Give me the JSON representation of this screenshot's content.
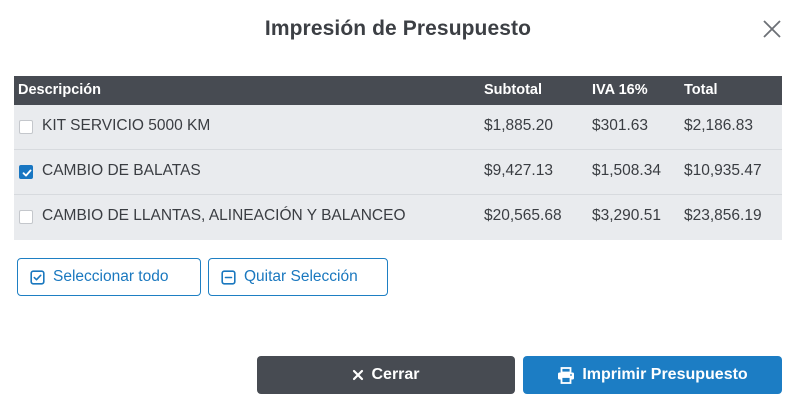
{
  "dialog": {
    "title": "Impresión de Presupuesto"
  },
  "table": {
    "headers": {
      "description": "Descripción",
      "subtotal": "Subtotal",
      "iva": "IVA 16%",
      "total": "Total"
    },
    "rows": [
      {
        "checked": false,
        "description": "KIT SERVICIO 5000 KM",
        "subtotal": "$1,885.20",
        "iva": "$301.63",
        "total": "$2,186.83"
      },
      {
        "checked": true,
        "description": "CAMBIO DE BALATAS",
        "subtotal": "$9,427.13",
        "iva": "$1,508.34",
        "total": "$10,935.47"
      },
      {
        "checked": false,
        "description": "CAMBIO DE LLANTAS, ALINEACIÓN Y BALANCEO",
        "subtotal": "$20,565.68",
        "iva": "$3,290.51",
        "total": "$23,856.19"
      }
    ]
  },
  "actions": {
    "select_all": "Seleccionar todo",
    "clear_selection": "Quitar Selección",
    "close": "Cerrar",
    "print": "Imprimir Presupuesto"
  },
  "colors": {
    "header_bg": "#474b52",
    "row_bg": "#e9ebee",
    "accent": "#1c7dc4",
    "dark_button": "#474b52"
  },
  "icons": {
    "close": "close-icon",
    "checkbox_checked": "check-icon",
    "select_all": "square-check-icon",
    "clear_selection": "square-minus-icon",
    "close_button": "x-icon",
    "print": "printer-icon"
  }
}
